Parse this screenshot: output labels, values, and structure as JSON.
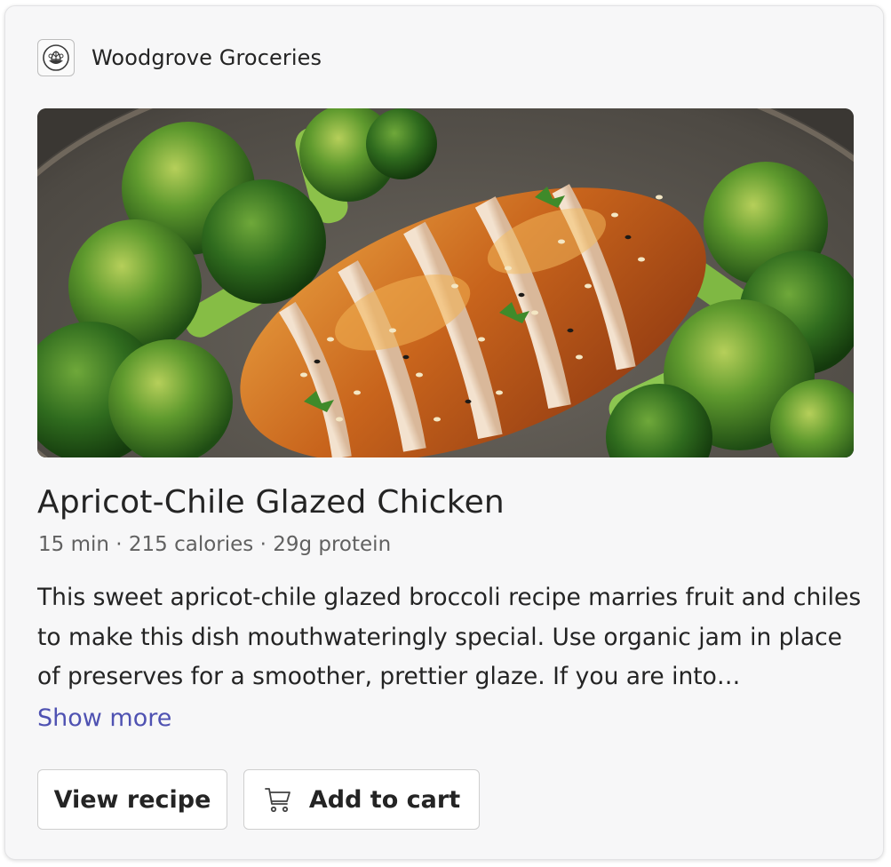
{
  "brand": {
    "name": "Woodgrove Groceries",
    "logo_icon": "vegetable-basket-logo"
  },
  "hero_image": {
    "icon": "glazed-chicken-broccoli-photo"
  },
  "recipe": {
    "title": "Apricot-Chile Glazed Chicken",
    "meta": "15 min · 215 calories · 29g protein",
    "description": "This sweet apricot-chile glazed broccoli recipe marries fruit and chiles to make this dish mouthwateringly special. Use organic jam in place of preserves for a smoother, prettier glaze. If you are into…",
    "show_more_label": "Show more"
  },
  "actions": {
    "view_recipe_label": "View recipe",
    "add_to_cart_label": "Add to cart",
    "add_to_cart_icon": "shopping-cart-icon"
  },
  "colors": {
    "link": "#4f52b2",
    "text": "#242424",
    "secondary_text": "#616161",
    "card_background": "#f7f7f8"
  }
}
